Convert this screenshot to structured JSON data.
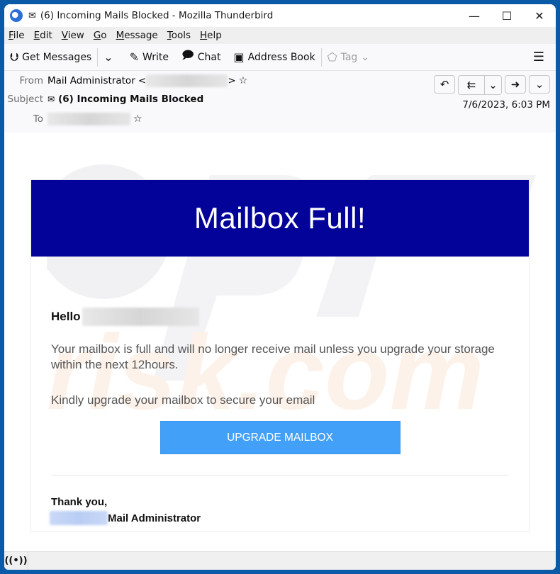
{
  "window": {
    "title": "(6) Incoming Mails Blocked - Mozilla Thunderbird",
    "controls": {
      "minimize": "—",
      "maximize": "☐",
      "close": "✕"
    }
  },
  "menubar": {
    "items": [
      {
        "label": "File",
        "accel": "F",
        "rest": "ile"
      },
      {
        "label": "Edit",
        "accel": "E",
        "rest": "dit"
      },
      {
        "label": "View",
        "accel": "V",
        "rest": "iew"
      },
      {
        "label": "Go",
        "accel": "G",
        "rest": "o"
      },
      {
        "label": "Message",
        "accel": "M",
        "rest": "essage"
      },
      {
        "label": "Tools",
        "accel": "T",
        "rest": "ools"
      },
      {
        "label": "Help",
        "accel": "H",
        "rest": "elp"
      }
    ]
  },
  "toolbar": {
    "get_messages": "Get Messages",
    "write": "Write",
    "chat": "Chat",
    "address_book": "Address Book",
    "tag": "Tag",
    "icons": {
      "get_messages": "⮋",
      "dropdown": "⌄",
      "write": "✎",
      "chat": "🗨",
      "address_book": "📇",
      "tag": "🏷",
      "menu": "☰"
    }
  },
  "header": {
    "from_label": "From",
    "from_name": "Mail Administrator <",
    "from_close": ">",
    "subject_label": "Subject",
    "subject": "(6) Incoming Mails Blocked",
    "to_label": "To",
    "date": "7/6/2023, 6:03 PM",
    "actions": {
      "reply": "↶",
      "reply_all": "⇇",
      "dropdown": "⌄",
      "forward": "➜",
      "more": "⌄"
    }
  },
  "email": {
    "banner_title": "Mailbox Full!",
    "greeting": "Hello",
    "paragraph1": "Your mailbox is full and will no longer receive mail unless you upgrade your storage within the next 12hours.",
    "paragraph2": "Kindly upgrade your mailbox to secure your email",
    "cta_label": "UPGRADE MAILBOX",
    "closing": "Thank you,",
    "signature": "Mail Administrator",
    "colors": {
      "banner": "#03039a",
      "cta": "#42a0f8"
    }
  },
  "statusbar": {
    "icon": "((•))"
  }
}
